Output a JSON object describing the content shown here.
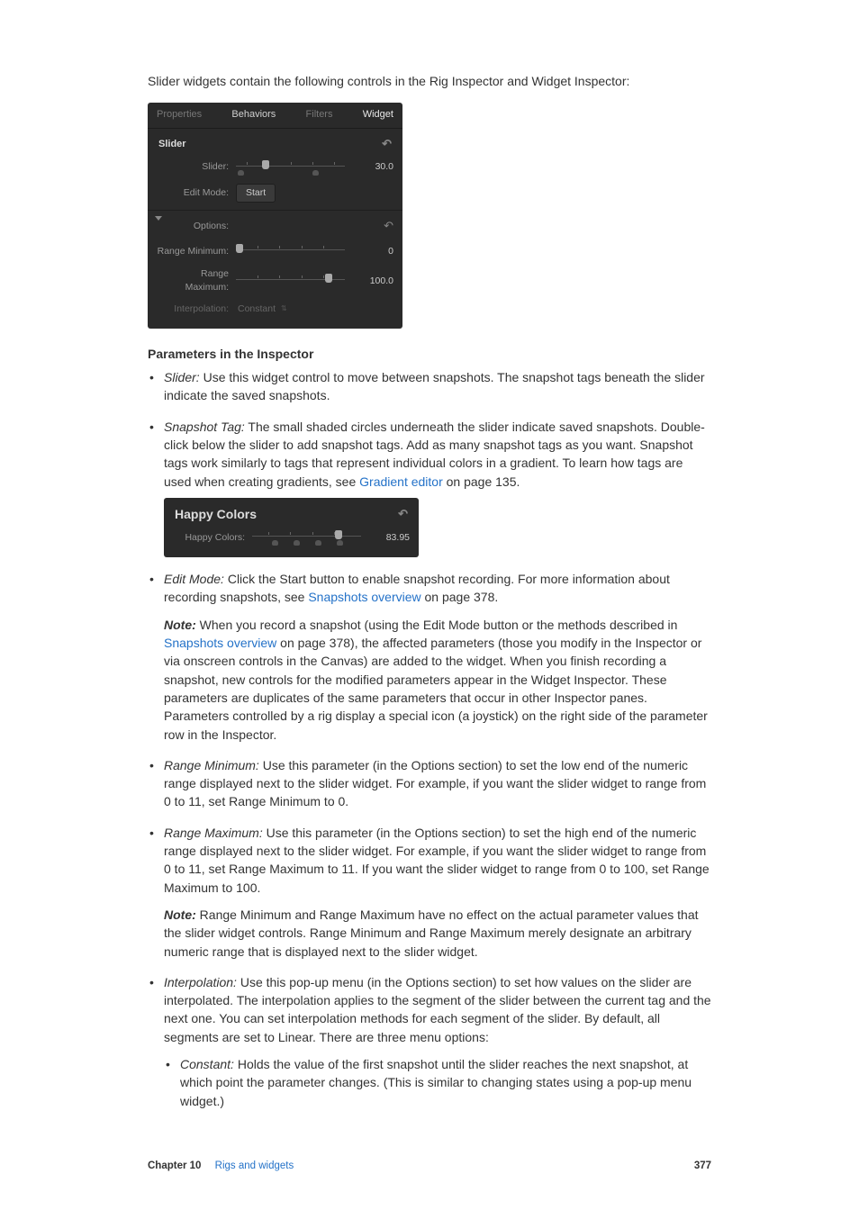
{
  "intro": "Slider widgets contain the following controls in the Rig Inspector and Widget Inspector:",
  "panel1": {
    "tabs": {
      "properties": "Properties",
      "behaviors": "Behaviors",
      "filters": "Filters",
      "widget": "Widget"
    },
    "section_slider": "Slider",
    "row_slider": {
      "label": "Slider:",
      "value": "30.0"
    },
    "row_editmode": {
      "label": "Edit Mode:",
      "button": "Start"
    },
    "section_options": "Options:",
    "row_rangemin": {
      "label": "Range Minimum:",
      "value": "0"
    },
    "row_rangemax": {
      "label": "Range Maximum:",
      "value": "100.0"
    },
    "row_interp": {
      "label": "Interpolation:",
      "value": "Constant"
    }
  },
  "heading_params": "Parameters in the Inspector",
  "p_slider": {
    "term": "Slider:",
    "text": " Use this widget control to move between snapshots. The snapshot tags beneath the slider indicate the saved snapshots."
  },
  "p_snapshot": {
    "term": "Snapshot Tag:",
    "text1": " The small shaded circles underneath the slider indicate saved snapshots. Double-click below the slider to add snapshot tags. Add as many snapshot tags as you want. Snapshot tags work similarly to tags that represent individual colors in a gradient. To learn how tags are used when creating gradients, see ",
    "link": "Gradient editor",
    "text2": " on page 135."
  },
  "panel2": {
    "title": "Happy Colors",
    "row": {
      "label": "Happy Colors:",
      "value": "83.95"
    }
  },
  "p_editmode": {
    "term": "Edit Mode:",
    "text1": " Click the Start button to enable snapshot recording. For more information about recording snapshots, see ",
    "link": "Snapshots overview",
    "text2": " on page 378."
  },
  "p_editmode_note": {
    "label": "Note:  ",
    "text1": "When you record a snapshot (using the Edit Mode button or the methods described in ",
    "link": "Snapshots overview",
    "text2": " on page 378), the affected parameters (those you modify in the Inspector or via onscreen controls in the Canvas) are added to the widget. When you finish recording a snapshot, new controls for the modified parameters appear in the Widget Inspector. These parameters are duplicates of the same parameters that occur in other Inspector panes. Parameters controlled by a rig display a special icon (a joystick) on the right side of the parameter row in the Inspector."
  },
  "p_rangemin": {
    "term": "Range Minimum:",
    "text": " Use this parameter (in the Options section) to set the low end of the numeric range displayed next to the slider widget. For example, if you want the slider widget to range from 0 to 11, set Range Minimum to 0."
  },
  "p_rangemax": {
    "term": "Range Maximum:",
    "text": " Use this parameter (in the Options section) to set the high end of the numeric range displayed next to the slider widget. For example, if you want the slider widget to range from 0 to 11, set Range Maximum to 11. If you want the slider widget to range from 0 to 100, set Range Maximum to 100."
  },
  "p_rangemax_note": {
    "label": "Note:  ",
    "text": "Range Minimum and Range Maximum have no effect on the actual parameter values that the slider widget controls. Range Minimum and Range Maximum merely designate an arbitrary numeric range that is displayed next to the slider widget."
  },
  "p_interp": {
    "term": "Interpolation:",
    "text": " Use this pop-up menu (in the Options section) to set how values on the slider are interpolated. The interpolation applies to the segment of the slider between the current tag and the next one. You can set interpolation methods for each segment of the slider. By default, all segments are set to Linear. There are three menu options:"
  },
  "p_constant": {
    "term": "Constant:",
    "text": " Holds the value of the first snapshot until the slider reaches the next snapshot, at which point the parameter changes. (This is similar to changing states using a pop-up menu widget.)"
  },
  "footer": {
    "chapter": "Chapter 10",
    "title": "Rigs and widgets",
    "page": "377"
  }
}
